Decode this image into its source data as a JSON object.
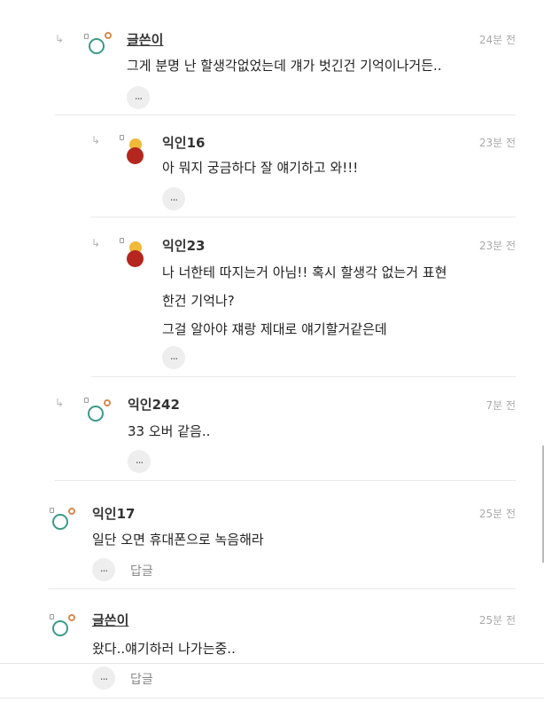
{
  "comments": [
    {
      "author": "글쓴이",
      "time": "24분 전",
      "lines": [
        "그게 분명 난 할생각없었는데 걔가 벗긴건 기억이나거든.."
      ],
      "more_icon": "..."
    },
    {
      "author": "익인16",
      "time": "23분 전",
      "lines": [
        "아 뭐지 궁금하다 잘 얘기하고 와!!!"
      ],
      "more_icon": "..."
    },
    {
      "author": "익인23",
      "time": "23분 전",
      "lines": [
        "나 너한테 따지는거 아님!! 혹시 할생각 없는거 표현",
        "한건 기억나?",
        "그걸 알아야 쟤랑 제대로 얘기할거같은데"
      ],
      "more_icon": "..."
    },
    {
      "author": "익인242",
      "time": "7분 전",
      "lines": [
        "33 오버 같음.."
      ],
      "more_icon": "..."
    },
    {
      "author": "익인17",
      "time": "25분 전",
      "lines": [
        "일단 오면 휴대폰으로 녹음해라"
      ],
      "more_icon": "...",
      "reply_label": "답글"
    },
    {
      "author": "글쓴이",
      "time": "25분 전",
      "lines": [
        "왔다..얘기하러 나가는중.."
      ],
      "more_icon": "...",
      "reply_label": "답글"
    }
  ],
  "icons": {
    "reply_arrow": "↳"
  },
  "colors": {
    "avatar_ring": "#3a9a8a",
    "avatar_ring_dot": "#d58a4e",
    "avatar_solid_top": "#f0b93a",
    "avatar_solid_bottom": "#b5261e"
  }
}
